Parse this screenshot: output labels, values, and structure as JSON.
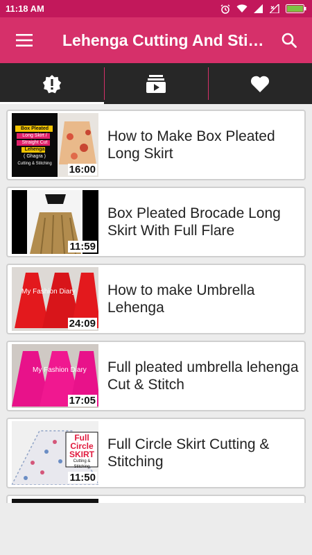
{
  "status": {
    "time": "11:18 AM"
  },
  "appbar": {
    "title": "Lehenga Cutting And Stitching",
    "menu_icon": "hamburger-icon",
    "search_icon": "search-icon"
  },
  "tabs": [
    {
      "icon": "alert-badge-icon",
      "active": true
    },
    {
      "icon": "video-library-icon",
      "active": false
    },
    {
      "icon": "heart-icon",
      "active": false
    }
  ],
  "videos": [
    {
      "title": "How to Make Box Pleated Long Skirt",
      "duration": "16:00",
      "thumb_text": [
        "Box Pleated",
        "Long Skirt /",
        "Straight Cut",
        "Lehenga",
        "( Ghagra )",
        "Cutting & Stitching"
      ]
    },
    {
      "title": "Box Pleated Brocade Long Skirt With Full Flare",
      "duration": "11:59"
    },
    {
      "title": "How to make Umbrella Lehenga",
      "duration": "24:09",
      "thumb_text": [
        "My Fashion Diary"
      ]
    },
    {
      "title": "Full pleated umbrella lehenga Cut & Stitch",
      "duration": "17:05",
      "thumb_text": [
        "My Fashion Diary"
      ]
    },
    {
      "title": "Full Circle Skirt Cutting & Stitching",
      "duration": "11:50",
      "thumb_text": [
        "Full",
        "Circle",
        "SKIRT",
        "Cutting & Stitching"
      ]
    }
  ],
  "colors": {
    "primary": "#d6306a",
    "status": "#c2185b",
    "tabbar": "#272727",
    "background": "#ececec"
  }
}
